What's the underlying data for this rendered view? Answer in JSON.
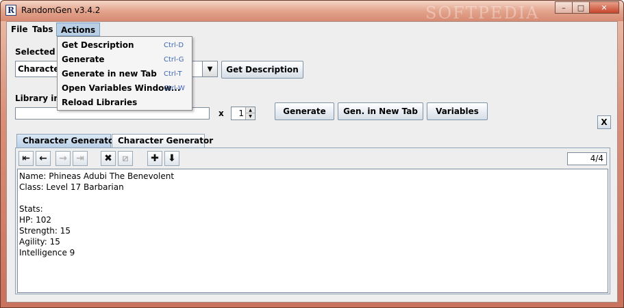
{
  "window": {
    "title": "RandomGen v3.4.2",
    "watermark": "SOFTPEDIA",
    "minimize": "–",
    "maximize": "□",
    "close": "✕"
  },
  "menubar": {
    "file": "File",
    "tabs": "Tabs",
    "actions": "Actions"
  },
  "actions_menu": {
    "items": [
      {
        "label": "Get Description",
        "accelerator": "Ctrl-D"
      },
      {
        "label": "Generate",
        "accelerator": "Ctrl-G"
      },
      {
        "label": "Generate in new Tab",
        "accelerator": "Ctrl-T"
      },
      {
        "label": "Open Variables Window...",
        "accelerator": "Ctrl-W"
      },
      {
        "label": "Reload Libraries",
        "accelerator": ""
      }
    ]
  },
  "library": {
    "selected_label": "Selected L",
    "selected_value": "Character",
    "get_description": "Get Description",
    "input_label": "Library inp",
    "input_value": "",
    "times": "x",
    "count": "1"
  },
  "buttons": {
    "generate": "Generate",
    "gen_new_tab": "Gen. in New Tab",
    "variables": "Variables",
    "close_tab": "X"
  },
  "tabs": [
    {
      "label": "Character Generator",
      "selected": true
    },
    {
      "label": "Character Generator",
      "selected": false
    }
  ],
  "toolbar": {
    "icons": [
      "first-icon",
      "previous-icon",
      "next-icon",
      "last-icon",
      "delete-icon",
      "delete-all-icon",
      "add-icon",
      "save-icon"
    ],
    "counter": "4/4"
  },
  "output": {
    "text": "Name: Phineas Adubi The Benevolent\nClass: Level 17 Barbarian\n\nStats:\nHP: 102\nStrength: 15\nAgility: 15\nIntelligence 9"
  }
}
